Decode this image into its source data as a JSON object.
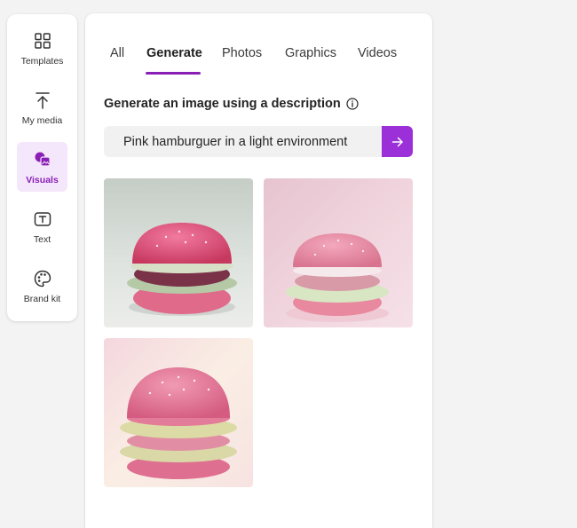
{
  "sidebar": {
    "items": [
      {
        "label": "Templates",
        "icon": "templates-icon"
      },
      {
        "label": "My media",
        "icon": "upload-icon"
      },
      {
        "label": "Visuals",
        "icon": "visuals-icon",
        "active": true
      },
      {
        "label": "Text",
        "icon": "text-icon"
      },
      {
        "label": "Brand kit",
        "icon": "palette-icon"
      }
    ]
  },
  "tabs": [
    {
      "label": "All"
    },
    {
      "label": "Generate",
      "active": true
    },
    {
      "label": "Photos"
    },
    {
      "label": "Graphics"
    },
    {
      "label": "Videos"
    }
  ],
  "generate": {
    "heading": "Generate an image using a description",
    "prompt_value": "Pink hamburguer in a light environment",
    "submit_icon": "arrow-right-icon"
  },
  "results": [
    {
      "subject": "pink burger, grey-green background"
    },
    {
      "subject": "pink burger, pink background"
    },
    {
      "subject": "pink burger, bright cream background"
    }
  ],
  "colors": {
    "accent": "#9b2fd8",
    "active_text": "#8a1fb5",
    "active_bg": "#f4e6fb"
  }
}
